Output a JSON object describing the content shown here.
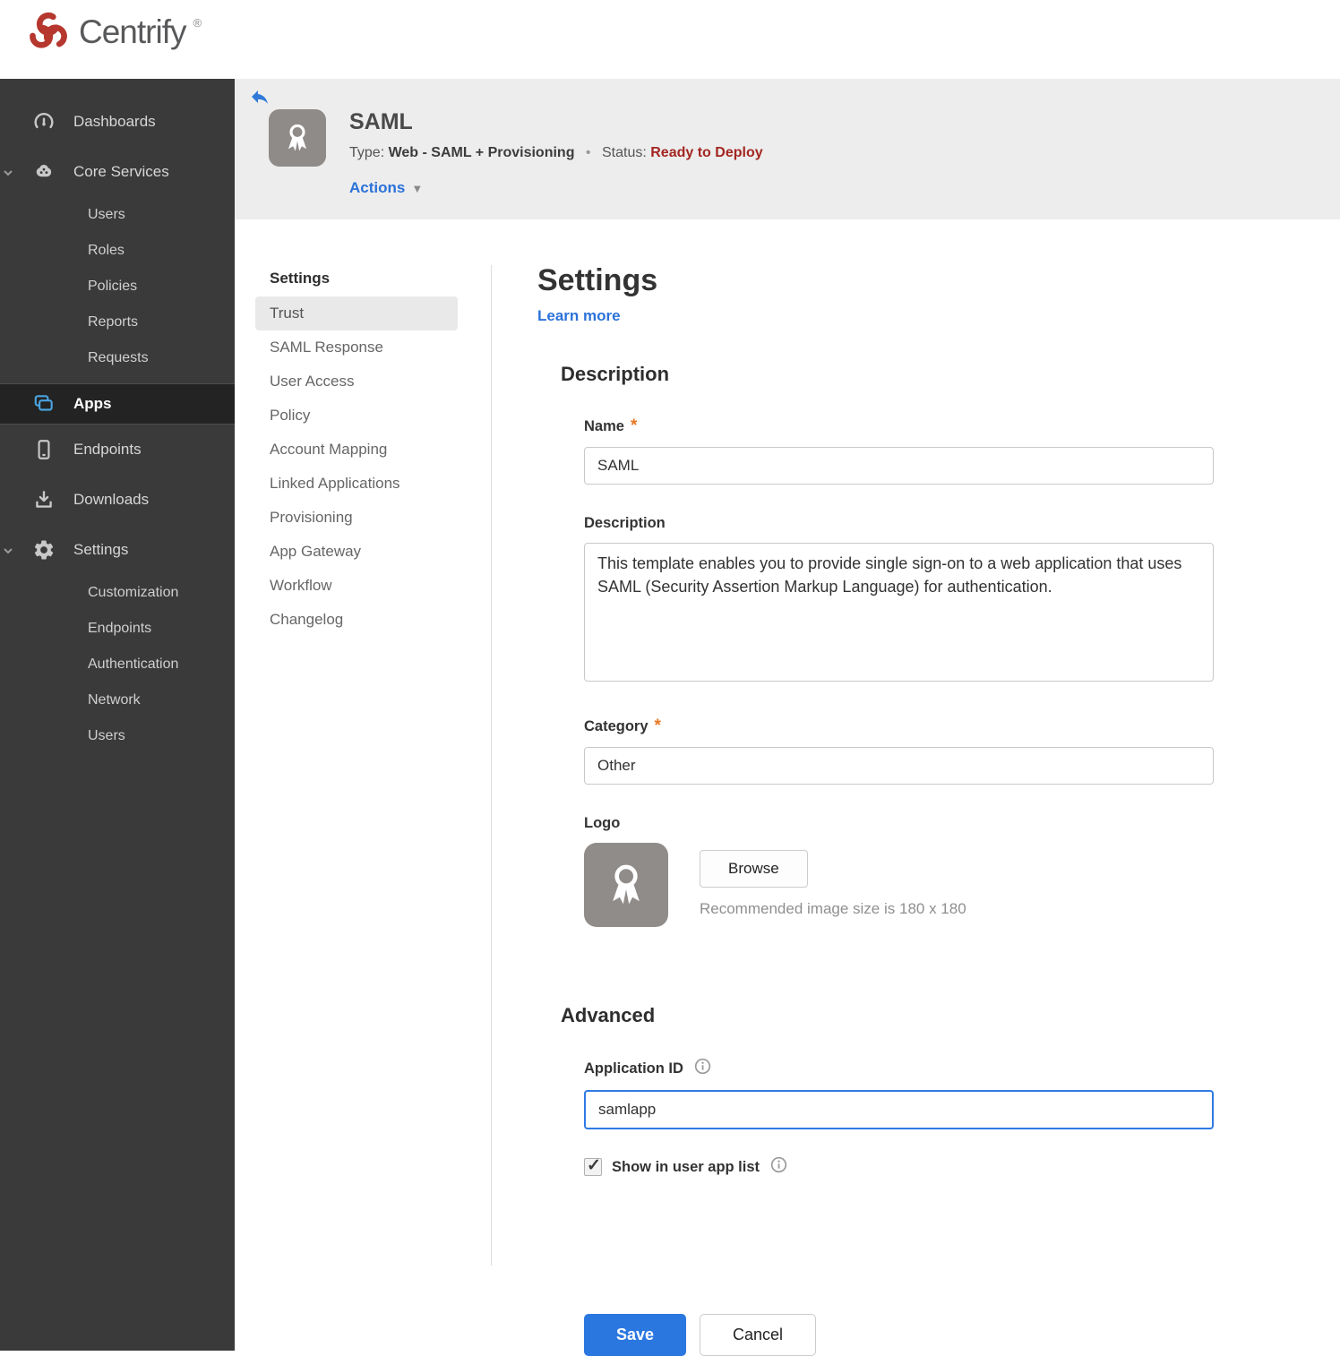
{
  "brand": {
    "name": "Centrify",
    "registered": "®",
    "logo_color": "#b5372e"
  },
  "sidebar": {
    "dashboards": "Dashboards",
    "core_services": "Core Services",
    "core_children": [
      "Users",
      "Roles",
      "Policies",
      "Reports",
      "Requests"
    ],
    "apps": "Apps",
    "endpoints": "Endpoints",
    "downloads": "Downloads",
    "settings": "Settings",
    "settings_children": [
      "Customization",
      "Endpoints",
      "Authentication",
      "Network",
      "Users"
    ]
  },
  "header": {
    "title": "SAML",
    "type_label": "Type:",
    "type_value": "Web - SAML + Provisioning",
    "separator": "•",
    "status_label": "Status:",
    "status_value": "Ready to Deploy",
    "status_color": "#a32622",
    "actions_label": "Actions"
  },
  "subnav": {
    "title": "Settings",
    "active_item": "Trust",
    "items": [
      "Trust",
      "SAML Response",
      "User Access",
      "Policy",
      "Account Mapping",
      "Linked Applications",
      "Provisioning",
      "App Gateway",
      "Workflow",
      "Changelog"
    ]
  },
  "main": {
    "heading": "Settings",
    "learn_more": "Learn more",
    "description_section": {
      "heading": "Description",
      "name_label": "Name",
      "name_value": "SAML",
      "description_label": "Description",
      "description_value": "This template enables you to provide single sign-on to a web application that uses SAML (Security Assertion Markup Language) for authentication.",
      "category_label": "Category",
      "category_value": "Other",
      "logo_label": "Logo",
      "browse_label": "Browse",
      "logo_hint": "Recommended image size is 180 x 180"
    },
    "advanced_section": {
      "heading": "Advanced",
      "app_id_label": "Application ID",
      "app_id_value": "samlapp",
      "show_in_list_label": "Show in user app list",
      "show_in_list_checked": true
    },
    "save_label": "Save",
    "cancel_label": "Cancel"
  },
  "icons": {
    "caret_down": "▼",
    "check": "✓"
  },
  "misc": {
    "required_marker": "*"
  },
  "colors": {
    "accent_blue": "#2b77e0",
    "link_blue": "#2b72d9",
    "status_red": "#a32622",
    "sidebar_bg": "#3a3a3a",
    "header_band_bg": "#ededed",
    "asterisk_orange": "#e87722"
  }
}
